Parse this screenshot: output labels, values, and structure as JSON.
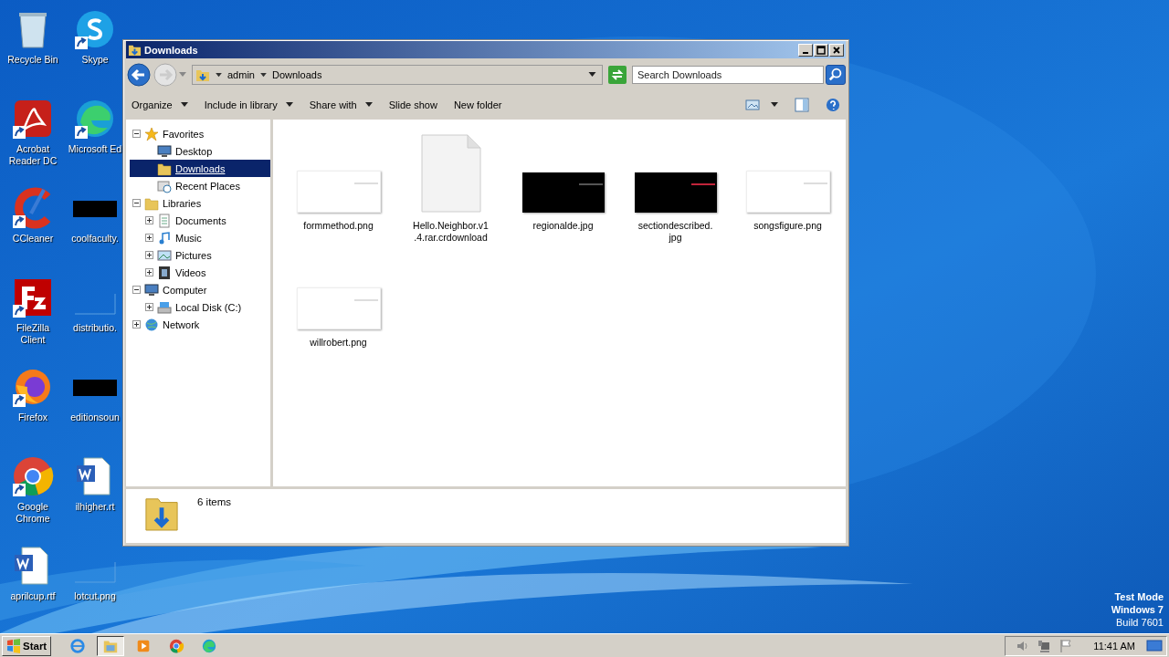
{
  "desktop_icons": [
    {
      "label": "Recycle Bin",
      "kind": "bin",
      "shortcut": false
    },
    {
      "label": "Skype",
      "kind": "skype",
      "shortcut": true
    },
    {
      "label": "Acrobat Reader DC",
      "kind": "acrobat",
      "shortcut": true
    },
    {
      "label": "Microsoft Ed",
      "kind": "edge",
      "shortcut": true
    },
    {
      "label": "CCleaner",
      "kind": "ccleaner",
      "shortcut": true
    },
    {
      "label": "coolfaculty.",
      "kind": "dark",
      "shortcut": false
    },
    {
      "label": "FileZilla Client",
      "kind": "filezilla",
      "shortcut": true
    },
    {
      "label": "distributio.",
      "kind": "blank",
      "shortcut": false
    },
    {
      "label": "Firefox",
      "kind": "firefox",
      "shortcut": true
    },
    {
      "label": "editionsoun",
      "kind": "dark",
      "shortcut": false
    },
    {
      "label": "Google Chrome",
      "kind": "chrome",
      "shortcut": true
    },
    {
      "label": "ilhigher.rt",
      "kind": "word",
      "shortcut": false
    },
    {
      "label": "aprilcup.rtf",
      "kind": "word",
      "shortcut": false
    },
    {
      "label": "lotcut.png",
      "kind": "blank",
      "shortcut": false
    }
  ],
  "window": {
    "title": "Downloads",
    "address": {
      "crumbs": [
        "admin",
        "Downloads"
      ]
    },
    "search": {
      "placeholder": "Search Downloads"
    },
    "toolbar": [
      {
        "label": "Organize",
        "dropdown": true
      },
      {
        "label": "Include in library",
        "dropdown": true
      },
      {
        "label": "Share with",
        "dropdown": true
      },
      {
        "label": "Slide show",
        "dropdown": false
      },
      {
        "label": "New folder",
        "dropdown": false
      }
    ],
    "nav": [
      {
        "label": "Favorites",
        "kind": "star",
        "expanded": true,
        "children": [
          {
            "label": "Desktop",
            "kind": "desktop",
            "selected": false
          },
          {
            "label": "Downloads",
            "kind": "downloads",
            "selected": true
          },
          {
            "label": "Recent Places",
            "kind": "recent",
            "selected": false
          }
        ]
      },
      {
        "label": "Libraries",
        "kind": "library",
        "expanded": true,
        "children": [
          {
            "label": "Documents",
            "kind": "documents",
            "selected": false,
            "expanded": false
          },
          {
            "label": "Music",
            "kind": "music",
            "selected": false,
            "expanded": false
          },
          {
            "label": "Pictures",
            "kind": "pictures",
            "selected": false,
            "expanded": false
          },
          {
            "label": "Videos",
            "kind": "videos",
            "selected": false,
            "expanded": false
          }
        ]
      },
      {
        "label": "Computer",
        "kind": "computer",
        "expanded": true,
        "children": [
          {
            "label": "Local Disk (C:)",
            "kind": "disk",
            "selected": false,
            "expanded": false
          }
        ]
      },
      {
        "label": "Network",
        "kind": "network",
        "expanded": false
      }
    ],
    "files": [
      {
        "name": "formmethod.png",
        "kind": "light-image"
      },
      {
        "name": "Hello.Neighbor.v1.4.rar.crdownload",
        "kind": "file"
      },
      {
        "name": "regionalde.jpg",
        "kind": "dark-image"
      },
      {
        "name": "sectiondescribed.jpg",
        "kind": "dark-image"
      },
      {
        "name": "songsfigure.png",
        "kind": "light-image"
      },
      {
        "name": "willrobert.png",
        "kind": "light-image"
      }
    ],
    "details": {
      "count": "6 items"
    }
  },
  "watermark_text": [
    "Test Mode",
    "Windows 7",
    "Build 7601"
  ],
  "taskbar": {
    "start": "Start",
    "apps": [
      {
        "kind": "ie",
        "selected": false
      },
      {
        "kind": "explorer",
        "selected": true
      },
      {
        "kind": "media",
        "selected": false
      },
      {
        "kind": "chrome",
        "selected": false
      },
      {
        "kind": "edge",
        "selected": false
      }
    ],
    "clock": "11:41 AM"
  }
}
